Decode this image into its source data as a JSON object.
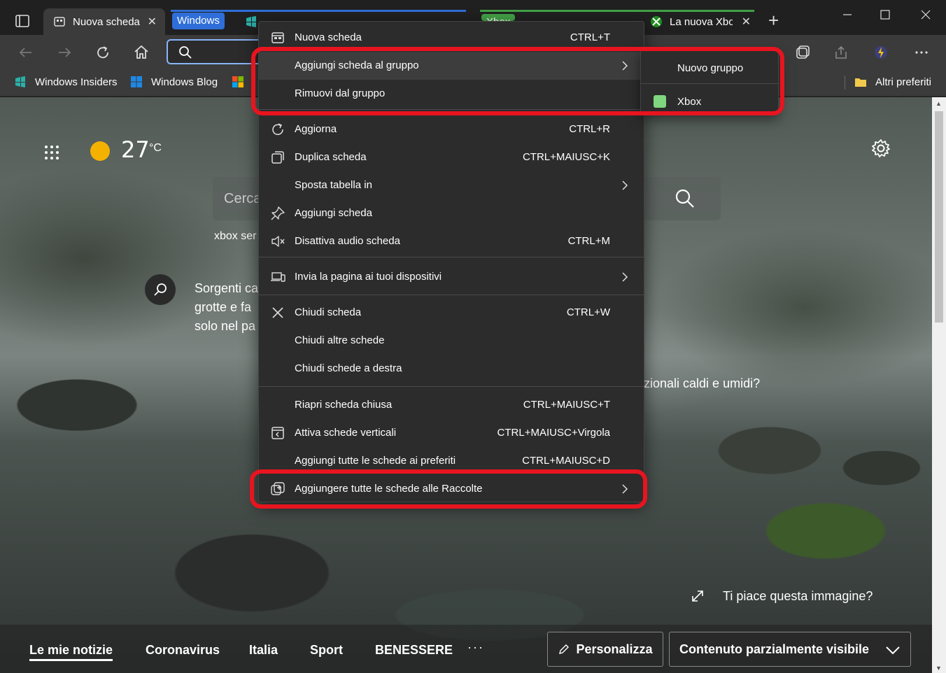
{
  "tabs": [
    {
      "title": "Nuova scheda",
      "close": "✕"
    },
    {
      "title": "La nuova Xbox",
      "close": "✕"
    }
  ],
  "groups": [
    {
      "label": "Windows",
      "color": "#2f6ed8"
    },
    {
      "label": "Xbox",
      "color": "#43a047"
    }
  ],
  "favorites": {
    "items": [
      {
        "label": "Windows Insiders"
      },
      {
        "label": "Windows Blog"
      }
    ],
    "other": "Altri preferiti"
  },
  "newtab_page": {
    "temperature": "27",
    "temp_unit": "°C",
    "search_placeholder": "Cerca",
    "trending": "xbox ser",
    "fact_text": "Sorgenti ca\ngrotte e fa\nsolo nel pa",
    "fact_text_right": "zionali caldi e umidi?",
    "like_image": "Ti piace questa immagine?",
    "news_tabs": [
      "Le mie notizie",
      "Coronavirus",
      "Italia",
      "Sport",
      "BENESSERE"
    ],
    "news_more": "···",
    "personalize": "Personalizza",
    "visibility": "Contenuto parzialmente visibile"
  },
  "context_menu": {
    "items": [
      {
        "label": "Nuova scheda",
        "shortcut": "CTRL+T",
        "icon": "new-tab-icon"
      },
      {
        "label": "Aggiungi scheda al gruppo",
        "shortcut": "",
        "icon": "",
        "submenu": true,
        "highlighted": true
      },
      {
        "label": "Rimuovi dal gruppo",
        "shortcut": "",
        "icon": ""
      },
      {
        "label": "Aggiorna",
        "shortcut": "CTRL+R",
        "icon": "refresh-icon"
      },
      {
        "label": "Duplica scheda",
        "shortcut": "CTRL+MAIUSC+K",
        "icon": "duplicate-icon"
      },
      {
        "label": "Sposta tabella in",
        "shortcut": "",
        "icon": "",
        "submenu": true
      },
      {
        "label": "Aggiungi scheda",
        "shortcut": "",
        "icon": "pin-icon"
      },
      {
        "label": "Disattiva audio scheda",
        "shortcut": "CTRL+M",
        "icon": "mute-icon"
      },
      {
        "label": "Invia la pagina ai tuoi dispositivi",
        "shortcut": "",
        "icon": "devices-icon",
        "submenu": true
      },
      {
        "label": "Chiudi scheda",
        "shortcut": "CTRL+W",
        "icon": "close-icon"
      },
      {
        "label": "Chiudi altre schede",
        "shortcut": "",
        "icon": ""
      },
      {
        "label": "Chiudi schede a destra",
        "shortcut": "",
        "icon": ""
      },
      {
        "label": "Riapri scheda chiusa",
        "shortcut": "CTRL+MAIUSC+T",
        "icon": ""
      },
      {
        "label": "Attiva schede verticali",
        "shortcut": "CTRL+MAIUSC+Virgola",
        "icon": "vertical-tabs-icon"
      },
      {
        "label": "Aggiungi tutte le schede ai preferiti",
        "shortcut": "CTRL+MAIUSC+D",
        "icon": ""
      },
      {
        "label": "Aggiungere tutte le schede alle Raccolte",
        "shortcut": "",
        "icon": "collections-icon",
        "submenu": true
      }
    ]
  },
  "group_submenu": {
    "new_group": "Nuovo gruppo",
    "existing_group": "Xbox",
    "existing_group_color": "#7fd67f"
  },
  "colors": {
    "annotation": "#e8141f",
    "accent": "#8ab4f8"
  }
}
